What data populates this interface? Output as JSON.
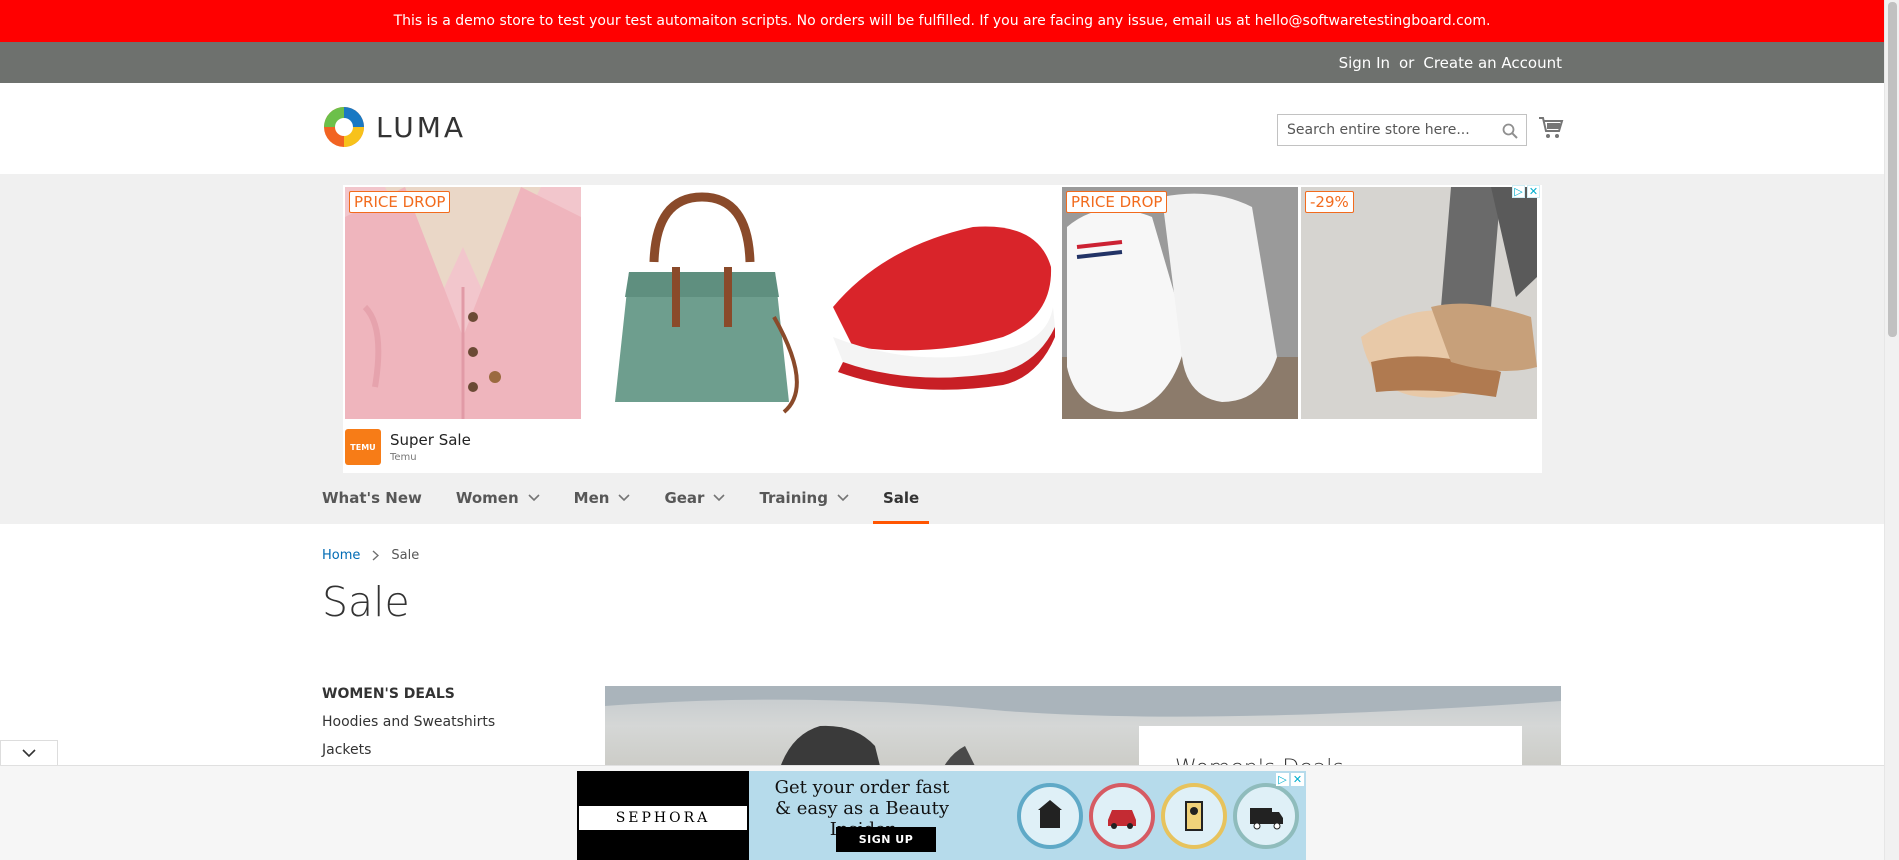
{
  "notice": {
    "text": "This is a demo store to test your test automaiton scripts. No orders will be fulfilled. If you are facing any issue, email us at hello@softwaretestingboard.com."
  },
  "header_links": {
    "sign_in": "Sign In",
    "or": "or",
    "create_account": "Create an Account"
  },
  "logo": {
    "text": "LUMA"
  },
  "search": {
    "placeholder": "Search entire store here..."
  },
  "ad": {
    "tiles": [
      {
        "badge": "PRICE DROP",
        "product": "pink cardigan"
      },
      {
        "badge": "",
        "product": "green handbag"
      },
      {
        "badge": "",
        "product": "red slip-on shoe"
      },
      {
        "badge": "PRICE DROP",
        "product": "white sneakers"
      },
      {
        "badge": "-29%",
        "product": "floral wedge sandals"
      }
    ],
    "brand_logo": "TEMU",
    "title": "Super Sale",
    "advertiser": "Temu"
  },
  "nav": {
    "items": [
      {
        "label": "What's New",
        "has_children": false
      },
      {
        "label": "Women",
        "has_children": true
      },
      {
        "label": "Men",
        "has_children": true
      },
      {
        "label": "Gear",
        "has_children": true
      },
      {
        "label": "Training",
        "has_children": true
      },
      {
        "label": "Sale",
        "has_children": false,
        "active": true
      }
    ]
  },
  "breadcrumb": {
    "home": "Home",
    "current": "Sale"
  },
  "page": {
    "title": "Sale"
  },
  "sidebar": {
    "heading": "WOMEN'S DEALS",
    "items": [
      "Hoodies and Sweatshirts",
      "Jackets"
    ]
  },
  "hero": {
    "card_title": "Women's Deals"
  },
  "bottom_ad": {
    "brand": "SEPHORA",
    "headline": "Get your order fast & easy as a Beauty Insider",
    "cta": "SIGN UP",
    "icon_names": [
      "same-day-delivery-icon",
      "car-pickup-icon",
      "store-pickup-icon",
      "delivery-truck-icon"
    ]
  },
  "colors": {
    "notice_bg": "#ff0000",
    "panel_bg": "#6e716e",
    "accent": "#ff5501",
    "link": "#006bb4"
  }
}
